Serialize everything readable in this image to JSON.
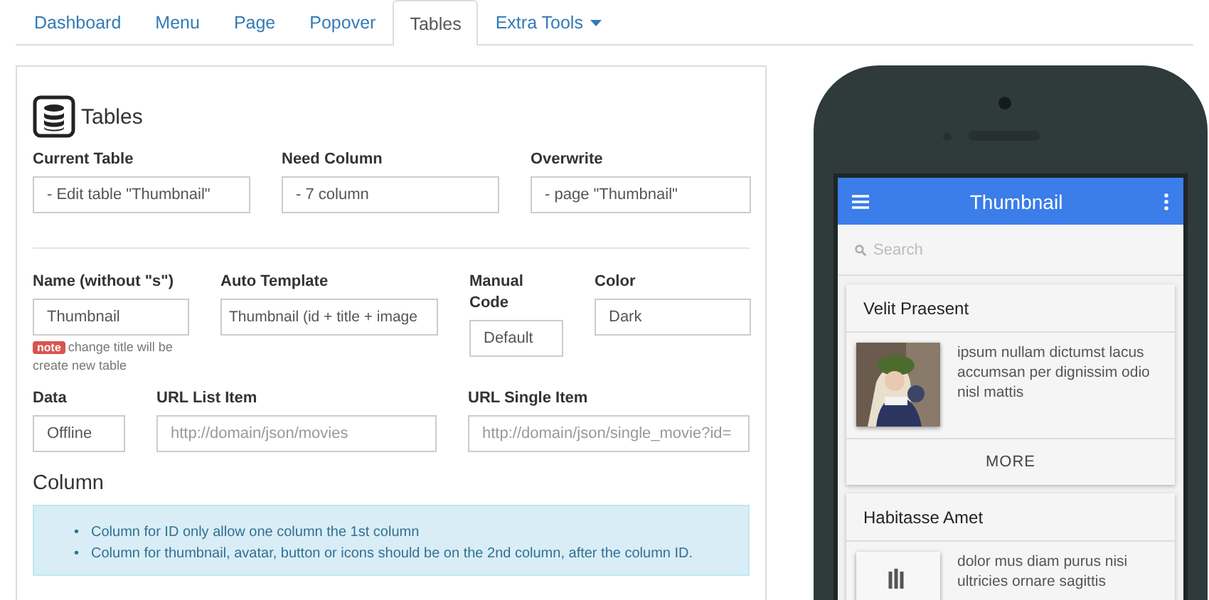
{
  "tabs": [
    {
      "label": "Dashboard",
      "selected": false,
      "kind": "link"
    },
    {
      "label": "Menu",
      "selected": false,
      "kind": "link"
    },
    {
      "label": "Page",
      "selected": false,
      "kind": "link"
    },
    {
      "label": "Popover",
      "selected": false,
      "kind": "link"
    },
    {
      "label": "Tables",
      "selected": true,
      "kind": "link"
    },
    {
      "label": "Extra Tools",
      "selected": false,
      "kind": "dropdown"
    }
  ],
  "panel": {
    "title": "Tables",
    "info_fields": [
      {
        "label": "Current Table",
        "value": "- Edit table \"Thumbnail\""
      },
      {
        "label": "Need Column",
        "value": "- 7 column"
      },
      {
        "label": "Overwrite",
        "value": "- page \"Thumbnail\""
      }
    ],
    "settings_row": [
      {
        "label": "Name (without \"s\")",
        "value": "Thumbnail",
        "badge": "note",
        "note": "change title will be create new table"
      },
      {
        "label": "Auto Template",
        "value": "Thumbnail (id + title + image"
      },
      {
        "label": "Manual Code",
        "value": "Default"
      },
      {
        "label": "Color",
        "value": "Dark"
      }
    ],
    "source_row": [
      {
        "label": "Data",
        "value": "Offline"
      },
      {
        "label": "URL List Item",
        "placeholder": "http://domain/json/movies"
      },
      {
        "label": "URL Single Item",
        "placeholder": "http://domain/json/single_movie?id="
      }
    ],
    "column_heading": "Column",
    "column_notes": [
      {
        "marker": "•",
        "text": "Column for ID only allow one column the 1st column"
      },
      {
        "marker": "•",
        "text": "Column for thumbnail, avatar, button or icons should be on the 2nd column, after the column ID."
      }
    ]
  },
  "phone": {
    "title": "Thumbnail",
    "search": {
      "placeholder": "Search"
    },
    "cards": [
      {
        "title": "Velit Praesent",
        "kind": "picture",
        "text": "ipsum nullam dictumst lacus accumsan per dignissim odio nisl mattis",
        "button": "MORE"
      },
      {
        "title": "Habitasse Amet",
        "kind": "placeholder",
        "text": "dolor mus diam purus nisi ultricies ornare sagittis"
      }
    ]
  }
}
